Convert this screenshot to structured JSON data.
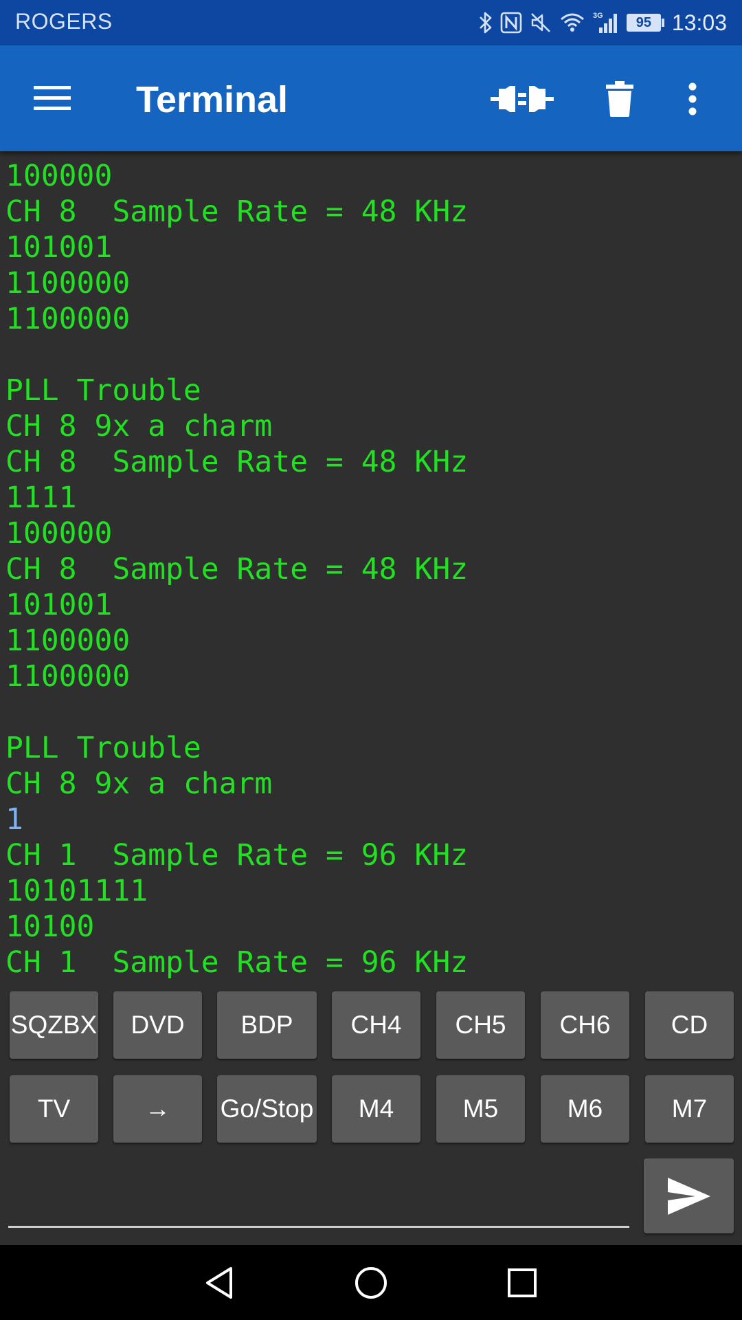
{
  "status_bar": {
    "carrier": "ROGERS",
    "battery_level": "95",
    "time": "13:03",
    "icons": [
      "bluetooth-icon",
      "nfc-icon",
      "mute-icon",
      "wifi-icon",
      "cell-signal-icon",
      "battery-icon"
    ],
    "network_type": "3G"
  },
  "app_bar": {
    "title": "Terminal",
    "icons": [
      "menu-icon",
      "connect-icon",
      "delete-icon",
      "more-vert-icon"
    ]
  },
  "terminal": {
    "received_color": "#22e022",
    "sent_color": "#7fb2f0",
    "lines": [
      {
        "text": "100000",
        "kind": "received"
      },
      {
        "text": "CH 8  Sample Rate = 48 KHz",
        "kind": "received"
      },
      {
        "text": "101001",
        "kind": "received"
      },
      {
        "text": "1100000",
        "kind": "received"
      },
      {
        "text": "1100000",
        "kind": "received"
      },
      {
        "text": "",
        "kind": "received"
      },
      {
        "text": "PLL Trouble",
        "kind": "received"
      },
      {
        "text": "CH 8 9x a charm",
        "kind": "received"
      },
      {
        "text": "CH 8  Sample Rate = 48 KHz",
        "kind": "received"
      },
      {
        "text": "1111",
        "kind": "received"
      },
      {
        "text": "100000",
        "kind": "received"
      },
      {
        "text": "CH 8  Sample Rate = 48 KHz",
        "kind": "received"
      },
      {
        "text": "101001",
        "kind": "received"
      },
      {
        "text": "1100000",
        "kind": "received"
      },
      {
        "text": "1100000",
        "kind": "received"
      },
      {
        "text": "",
        "kind": "received"
      },
      {
        "text": "PLL Trouble",
        "kind": "received"
      },
      {
        "text": "CH 8 9x a charm",
        "kind": "received"
      },
      {
        "text": "1",
        "kind": "sent"
      },
      {
        "text": "CH 1  Sample Rate = 96 KHz",
        "kind": "received"
      },
      {
        "text": "10101111",
        "kind": "received"
      },
      {
        "text": "10100",
        "kind": "received"
      },
      {
        "text": "CH 1  Sample Rate = 96 KHz",
        "kind": "received"
      }
    ]
  },
  "macros": {
    "row1": [
      "SQZBX",
      "DVD",
      "BDP",
      "CH4",
      "CH5",
      "CH6",
      "CD"
    ],
    "row2": [
      "TV",
      "→",
      "Go/Stop",
      "M4",
      "M5",
      "M6",
      "M7"
    ]
  },
  "input": {
    "value": "",
    "placeholder": ""
  },
  "nav_bar": {
    "icons": [
      "back-icon",
      "home-icon",
      "recents-icon"
    ]
  }
}
